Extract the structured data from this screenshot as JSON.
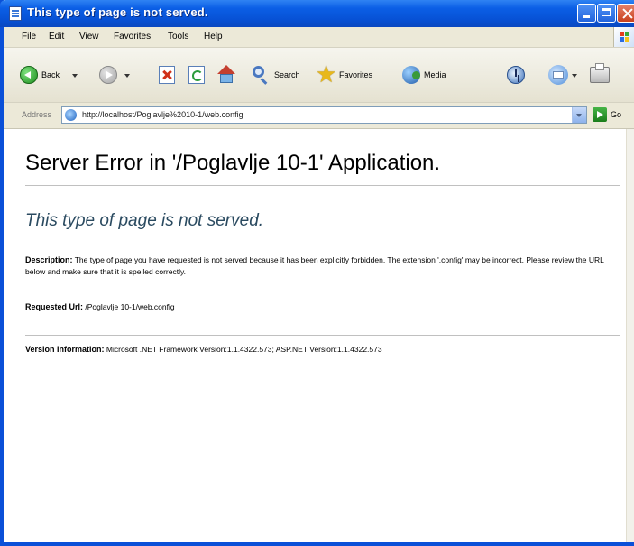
{
  "window": {
    "title": "This type of page is not served."
  },
  "menu": {
    "items": [
      "File",
      "Edit",
      "View",
      "Favorites",
      "Tools",
      "Help"
    ]
  },
  "toolbar": {
    "back_label": "Back",
    "search_label": "Search",
    "favorites_label": "Favorites",
    "media_label": "Media"
  },
  "address": {
    "label": "Address",
    "url": "http://localhost/Poglavlje%2010-1/web.config",
    "go_label": "Go"
  },
  "page": {
    "server_error_title": "Server Error in '/Poglavlje 10-1' Application.",
    "error_heading": "This type of page is not served.",
    "description_label": "Description:",
    "description_text": "The type of page you have requested is not served because it has been explicitly forbidden. The extension '.config' may be incorrect. Please review the URL below and make sure that it is spelled correctly.",
    "requested_url_label": "Requested Url:",
    "requested_url_value": "/Poglavlje 10-1/web.config",
    "version_label": "Version Information:",
    "version_text": "Microsoft .NET Framework Version:1.1.4322.573; ASP.NET Version:1.1.4322.573"
  },
  "colors": {
    "titlebar": "#0752d6",
    "error_heading": "#2a4a60",
    "chrome": "#ece9d8"
  }
}
